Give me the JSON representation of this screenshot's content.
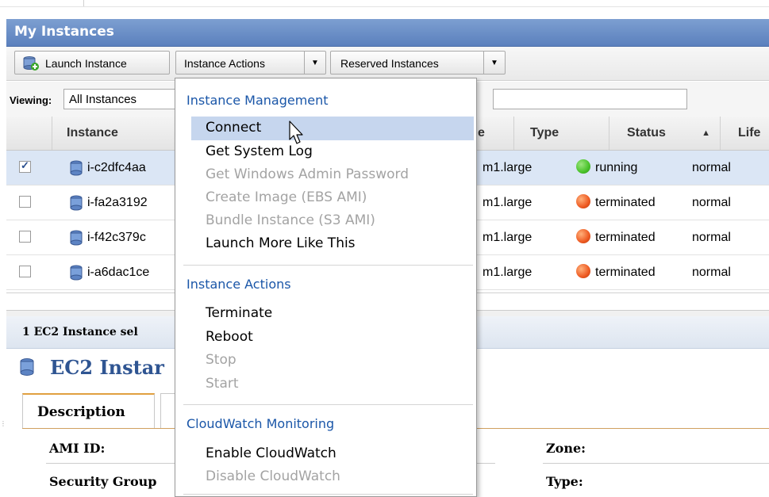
{
  "panel": {
    "title": "My Instances"
  },
  "toolbar": {
    "launch_label": "Launch Instance",
    "actions_label": "Instance Actions",
    "reserved_label": "Reserved Instances"
  },
  "viewing": {
    "label": "Viewing:",
    "selected": "All Instances",
    "search_value": ""
  },
  "grid": {
    "columns": {
      "instance": "Instance",
      "type_partial": "e",
      "type": "Type",
      "status": "Status",
      "lifecycle": "Life"
    },
    "rows": [
      {
        "checked": true,
        "instance": "i-c2dfc4aa",
        "type": "m1.large",
        "status": "running",
        "status_color": "#49c22a",
        "lifecycle": "normal"
      },
      {
        "checked": false,
        "instance": "i-fa2a3192",
        "type": "m1.large",
        "status": "terminated",
        "status_color": "#ee5a22",
        "lifecycle": "normal"
      },
      {
        "checked": false,
        "instance": "i-f42c379c",
        "type": "m1.large",
        "status": "terminated",
        "status_color": "#ee5a22",
        "lifecycle": "normal"
      },
      {
        "checked": false,
        "instance": "i-a6dac1ce",
        "type": "m1.large",
        "status": "terminated",
        "status_color": "#ee5a22",
        "lifecycle": "normal"
      }
    ]
  },
  "detail": {
    "selected_text": "1 EC2 Instance sel",
    "title": "EC2 Instar",
    "tab_description": "Description",
    "labels": {
      "ami_id": "AMI ID:",
      "security_group": "Security Group",
      "zone": "Zone:",
      "type": "Type:"
    }
  },
  "menu": {
    "sections": [
      {
        "title": "Instance Management",
        "items": [
          {
            "label": "Connect",
            "enabled": true,
            "highlighted": true
          },
          {
            "label": "Get System Log",
            "enabled": true
          },
          {
            "label": "Get Windows Admin Password",
            "enabled": false
          },
          {
            "label": "Create Image (EBS AMI)",
            "enabled": false
          },
          {
            "label": "Bundle Instance (S3 AMI)",
            "enabled": false
          },
          {
            "label": "Launch More Like This",
            "enabled": true
          }
        ]
      },
      {
        "title": "Instance Actions",
        "items": [
          {
            "label": "Terminate",
            "enabled": true
          },
          {
            "label": "Reboot",
            "enabled": true
          },
          {
            "label": "Stop",
            "enabled": false
          },
          {
            "label": "Start",
            "enabled": false
          }
        ]
      },
      {
        "title": "CloudWatch Monitoring",
        "items": [
          {
            "label": "Enable CloudWatch",
            "enabled": true
          },
          {
            "label": "Disable CloudWatch",
            "enabled": false
          }
        ]
      }
    ]
  },
  "colors": {
    "header_blue": "#5b80bd",
    "menu_section": "#1a56a8",
    "highlight": "#c6d6ee"
  },
  "icons": [
    "database-icon",
    "launch-icon",
    "cursor-icon"
  ]
}
